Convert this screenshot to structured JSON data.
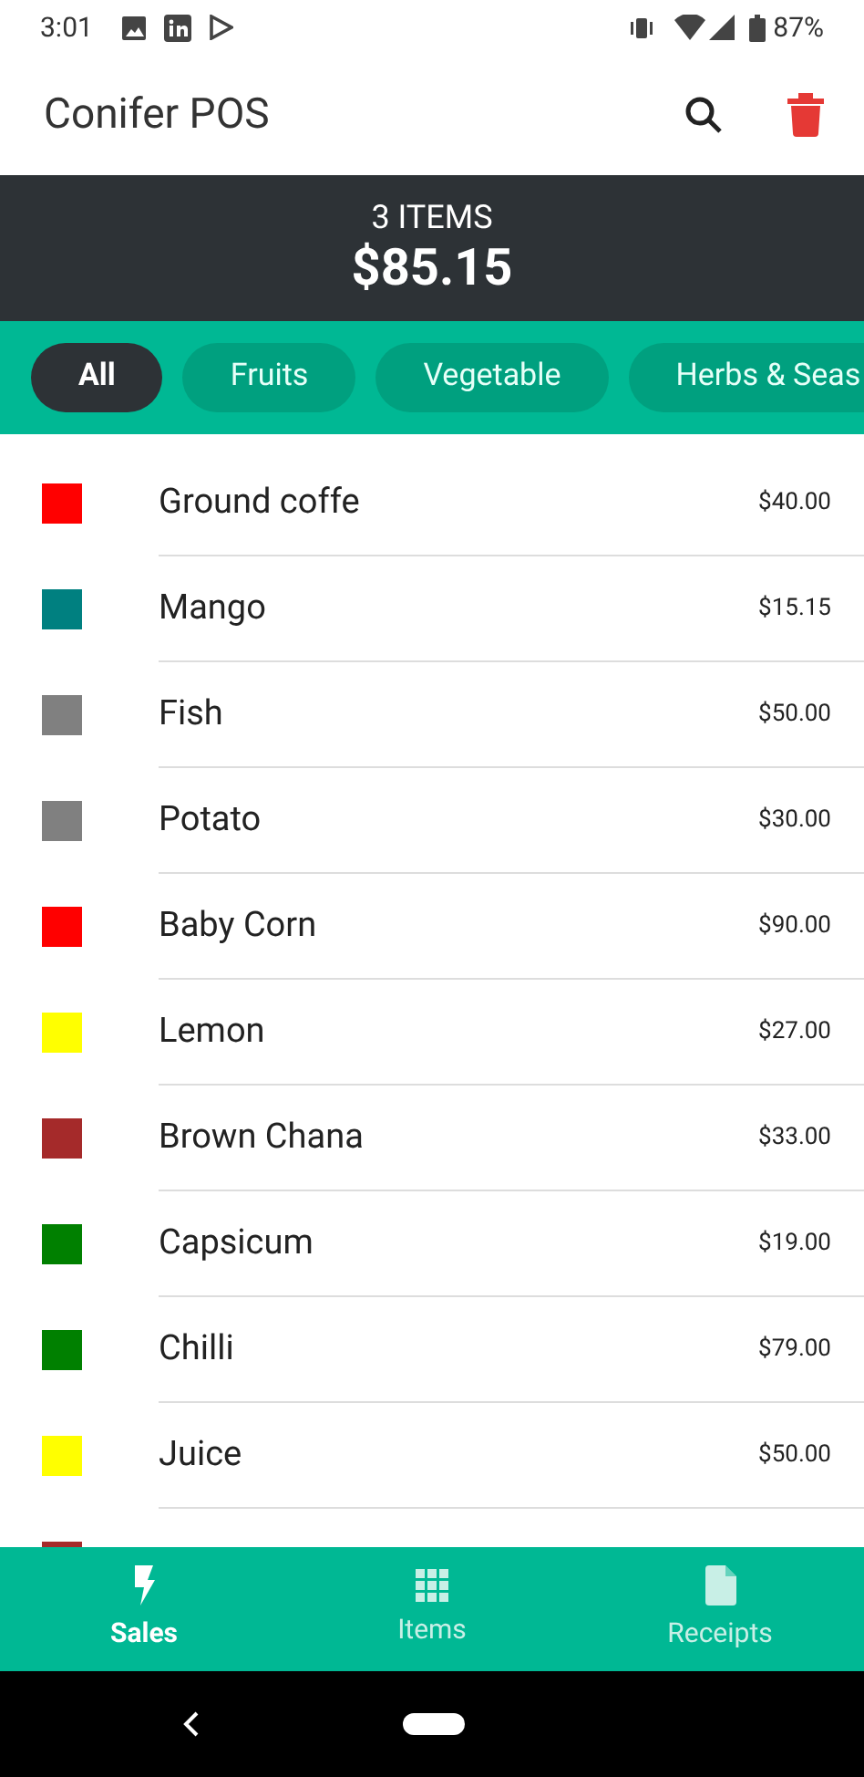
{
  "status_bar": {
    "time": "3:01",
    "battery": "87%"
  },
  "app_bar": {
    "title": "Conifer POS"
  },
  "summary": {
    "count": "3 ITEMS",
    "total": "$85.15"
  },
  "categories": [
    {
      "label": "All",
      "selected": true
    },
    {
      "label": "Fruits",
      "selected": false
    },
    {
      "label": "Vegetable",
      "selected": false
    },
    {
      "label": "Herbs & Seas",
      "selected": false
    }
  ],
  "products": [
    {
      "name": "Ground coffe",
      "price": "$40.00",
      "color": "#ff0000"
    },
    {
      "name": "Mango",
      "price": "$15.15",
      "color": "#008080"
    },
    {
      "name": "Fish",
      "price": "$50.00",
      "color": "#808080"
    },
    {
      "name": "Potato",
      "price": "$30.00",
      "color": "#808080"
    },
    {
      "name": "Baby Corn",
      "price": "$90.00",
      "color": "#ff0000"
    },
    {
      "name": "Lemon",
      "price": "$27.00",
      "color": "#ffff00"
    },
    {
      "name": "Brown Chana",
      "price": "$33.00",
      "color": "#a52a2a"
    },
    {
      "name": "Capsicum",
      "price": "$19.00",
      "color": "#008000"
    },
    {
      "name": "Chilli",
      "price": "$79.00",
      "color": "#008000"
    },
    {
      "name": "Juice",
      "price": "$50.00",
      "color": "#ffff00"
    },
    {
      "color": "#a52a2a"
    }
  ],
  "bottom_nav": [
    {
      "label": "Sales",
      "kind": "sales",
      "selected": true
    },
    {
      "label": "Items",
      "kind": "items",
      "selected": false
    },
    {
      "label": "Receipts",
      "kind": "receipts",
      "selected": false
    }
  ]
}
